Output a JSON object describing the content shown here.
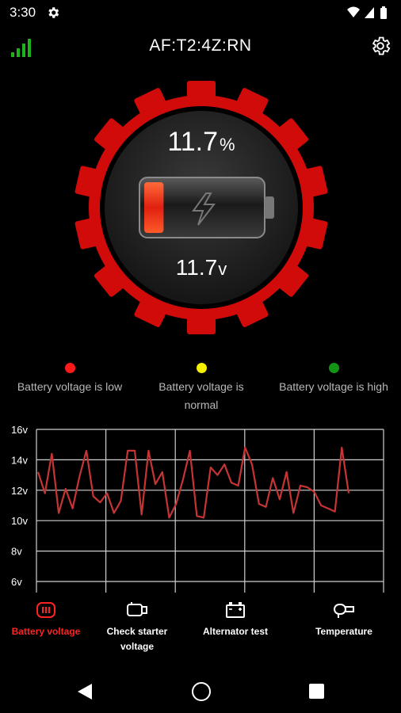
{
  "status_bar": {
    "time": "3:30",
    "icons": [
      "settings-icon",
      "wifi-icon",
      "cell-signal-icon",
      "battery-icon"
    ]
  },
  "header": {
    "title": "AF:T2:4Z:RN",
    "signal_icon": "signal-bars-icon",
    "settings_icon": "gear-icon"
  },
  "gauge": {
    "percent_value": "11.7",
    "percent_unit": "%",
    "voltage_value": "11.7",
    "voltage_unit": "v",
    "charge_level": 0.117,
    "ring_color": "#d10a0a"
  },
  "legend": [
    {
      "label": "Battery voltage is low",
      "color": "#ff1a1a"
    },
    {
      "label": "Battery voltage is normal",
      "color": "#f5ef00"
    },
    {
      "label": "Battery voltage is high",
      "color": "#149414"
    }
  ],
  "chart_data": {
    "type": "line",
    "ylabels": [
      "16v",
      "14v",
      "12v",
      "10v",
      "8v",
      "6v"
    ],
    "ylim": [
      6,
      16
    ],
    "grid": true,
    "line_color": "#c63434",
    "series": [
      {
        "values": [
          13.2,
          11.8,
          14.4,
          10.5,
          12.1,
          10.8,
          12.9,
          14.6,
          11.6,
          11.2,
          11.8,
          10.5,
          11.3,
          14.6,
          14.6,
          10.4,
          14.6,
          12.4,
          13.2,
          10.2,
          11.1,
          12.7,
          14.6,
          10.3,
          10.2,
          13.5,
          13.0,
          13.7,
          12.5,
          12.3,
          14.8,
          13.7,
          11.1,
          10.9,
          12.8,
          11.4,
          13.2,
          10.5,
          12.3,
          12.2,
          11.9,
          11.0,
          10.8,
          10.6,
          14.8,
          11.8
        ]
      }
    ]
  },
  "bottom_nav": [
    {
      "label": "Battery voltage",
      "icon": "battery-voltage-icon",
      "active": true
    },
    {
      "label": "Check starter voltage",
      "icon": "starter-motor-icon",
      "active": false
    },
    {
      "label": "Alternator test",
      "icon": "car-battery-icon",
      "active": false
    },
    {
      "label": "Temperature",
      "icon": "temperature-sensor-icon",
      "active": false
    }
  ],
  "colors": {
    "active": "#ff2222",
    "inactive": "#ffffff",
    "background": "#000000"
  }
}
